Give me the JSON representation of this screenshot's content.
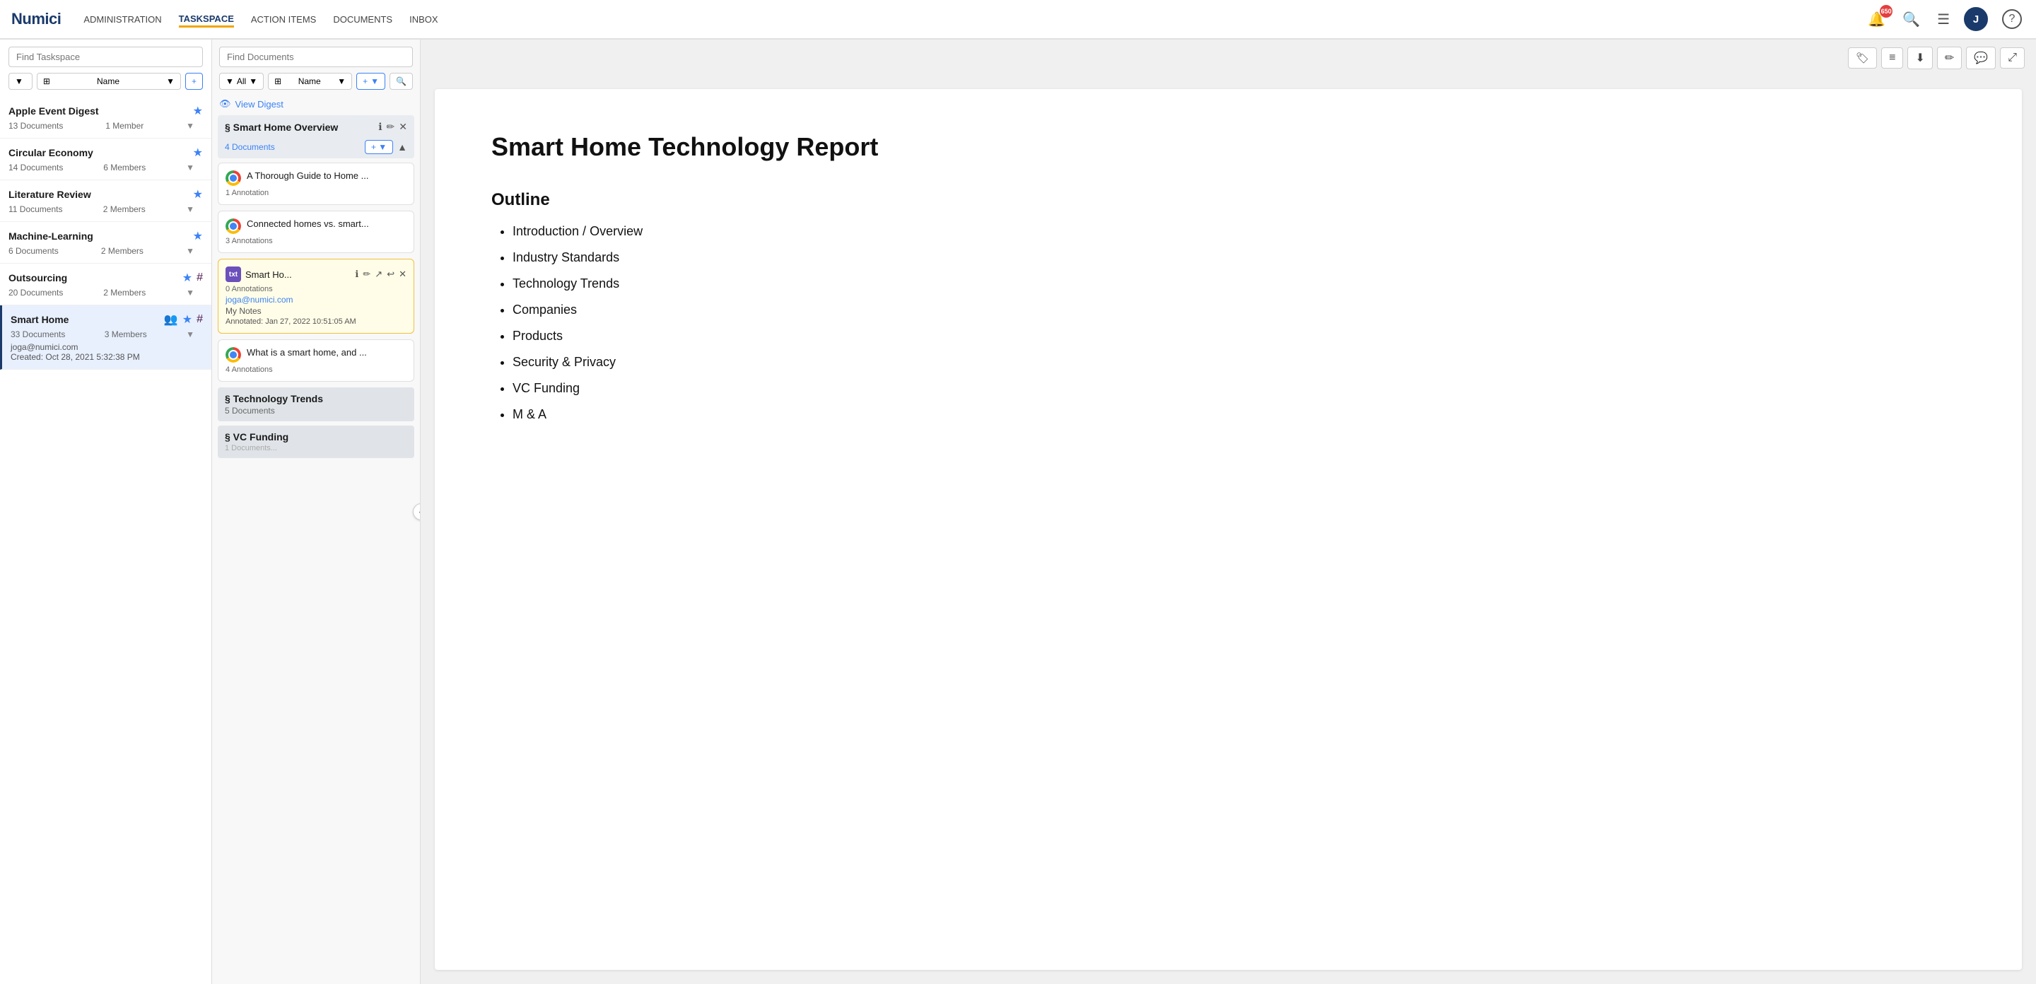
{
  "app": {
    "logo": "Numici"
  },
  "nav": {
    "links": [
      {
        "label": "ADMINISTRATION",
        "active": false
      },
      {
        "label": "TASKSPACE",
        "active": true
      },
      {
        "label": "ACTION ITEMS",
        "active": false
      },
      {
        "label": "DOCUMENTS",
        "active": false
      },
      {
        "label": "INBOX",
        "active": false
      }
    ],
    "notification_count": "650",
    "avatar_initial": "J"
  },
  "left_sidebar": {
    "search_placeholder": "Find Taskspace",
    "filter_label": "Filter",
    "sort_label": "Name",
    "add_label": "+",
    "taskspaces": [
      {
        "name": "Apple Event Digest",
        "docs": "13 Documents",
        "members": "1 Member",
        "starred": true,
        "active": false
      },
      {
        "name": "Circular Economy",
        "docs": "14 Documents",
        "members": "6 Members",
        "starred": true,
        "active": false
      },
      {
        "name": "Literature Review",
        "docs": "11 Documents",
        "members": "2 Members",
        "starred": true,
        "active": false
      },
      {
        "name": "Machine-Learning",
        "docs": "6 Documents",
        "members": "2 Members",
        "starred": true,
        "active": false
      },
      {
        "name": "Outsourcing",
        "docs": "20 Documents",
        "members": "2 Members",
        "starred": true,
        "has_extra_icon": true,
        "active": false
      },
      {
        "name": "Smart Home",
        "docs": "33 Documents",
        "members": "3 Members",
        "starred": true,
        "has_extra_icon": true,
        "has_group_icon": true,
        "active": true,
        "owner": "joga@numici.com",
        "created": "Created: Oct 28, 2021 5:32:38 PM"
      }
    ]
  },
  "middle_panel": {
    "search_placeholder": "Find Documents",
    "filter_label": "All",
    "sort_label": "Name",
    "add_label": "+",
    "view_digest_label": "View Digest",
    "sections": [
      {
        "id": "smart-home-overview",
        "title": "§ Smart Home Overview",
        "doc_count": "4 Documents",
        "expanded": true,
        "documents": [
          {
            "id": "doc1",
            "title": "A Thorough Guide to Home ...",
            "annotations": "1 Annotation",
            "type": "chrome",
            "highlighted": false
          },
          {
            "id": "doc2",
            "title": "Connected homes vs. smart...",
            "annotations": "3 Annotations",
            "type": "chrome",
            "highlighted": false
          },
          {
            "id": "doc3",
            "title": "Smart Ho...",
            "annotations": "0 Annotations",
            "type": "txt",
            "highlighted": true,
            "email": "joga@numici.com",
            "notes_label": "My Notes",
            "annotated_label": "Annotated: Jan 27, 2022 10:51:05 AM"
          },
          {
            "id": "doc4",
            "title": "What is a smart home, and ...",
            "annotations": "4 Annotations",
            "type": "chrome",
            "highlighted": false
          }
        ]
      },
      {
        "id": "technology-trends",
        "title": "§ Technology Trends",
        "doc_count": "5 Documents",
        "expanded": false
      },
      {
        "id": "vc-funding",
        "title": "§ VC Funding",
        "doc_count": "1 Documents",
        "expanded": false
      }
    ]
  },
  "document": {
    "title": "Smart Home Technology Report",
    "outline_label": "Outline",
    "outline_items": [
      "Introduction / Overview",
      "Industry Standards",
      "Technology Trends",
      "Companies",
      "Products",
      "Security & Privacy",
      "VC Funding",
      "M & A"
    ]
  },
  "right_toolbar": {
    "tag_icon": "🏷",
    "list_icon": "≡",
    "download_icon": "↓",
    "edit_icon": "✏",
    "comment_icon": "💬",
    "expand_icon": "⤢"
  }
}
